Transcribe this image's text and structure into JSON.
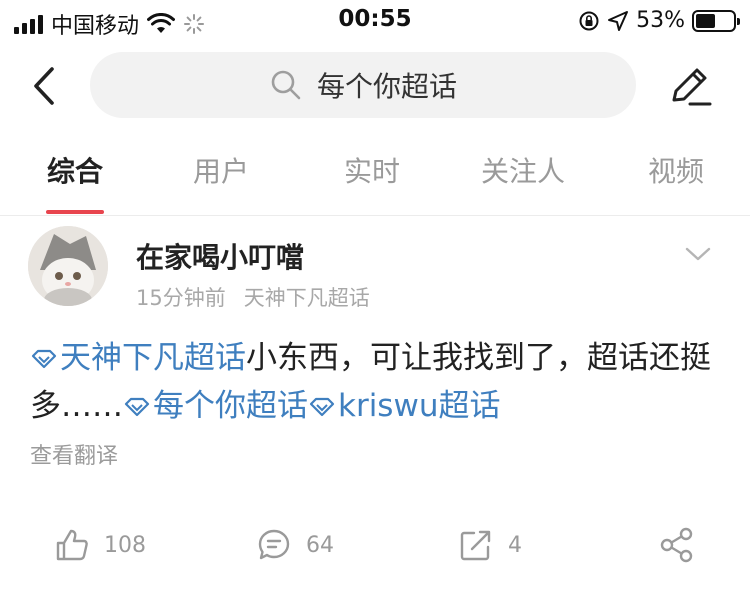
{
  "status_bar": {
    "carrier": "中国移动",
    "time": "00:55",
    "battery_percent": "53%",
    "battery_level": 0.53,
    "icons": [
      "signal-icon",
      "wifi-icon",
      "loading-icon",
      "orientation-lock-icon",
      "location-icon",
      "battery-icon"
    ]
  },
  "header": {
    "search_query": "每个你超话",
    "icons": [
      "back-icon",
      "search-icon",
      "edit-icon"
    ]
  },
  "tabs": [
    {
      "label": "综合",
      "active": true
    },
    {
      "label": "用户",
      "active": false
    },
    {
      "label": "实时",
      "active": false
    },
    {
      "label": "关注人",
      "active": false
    },
    {
      "label": "视频",
      "active": false
    }
  ],
  "colors": {
    "accent": "#e8454e",
    "topic_link": "#3f7fbf",
    "muted": "#9a9a9a"
  },
  "post": {
    "username": "在家喝小叮噹",
    "time": "15分钟前",
    "source": "天神下凡超话",
    "topic1": "天神下凡超话",
    "text1": "小东西，可让我找到了，超话还挺多……",
    "topic2": "每个你超话",
    "topic3": "kriswu超话",
    "translate": "查看翻译",
    "likes": "108",
    "comments": "64",
    "reposts": "4"
  }
}
